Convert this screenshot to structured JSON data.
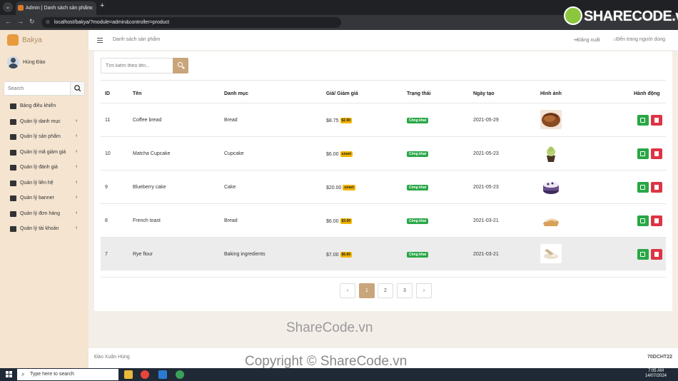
{
  "browser": {
    "tab_title": "Admin | Danh sách sản phẩm",
    "url": "localhost/bakya/?module=admin&controller=product"
  },
  "brand_watermark": "SHARECODE.vn",
  "sidebar": {
    "brand": "Bakya",
    "user_name": "Hùng Đào",
    "search_placeholder": "Search",
    "items": [
      {
        "label": "Bảng điều khiển",
        "icon": "dashboard-icon",
        "chevron": ""
      },
      {
        "label": "Quản lý danh mục",
        "icon": "list-icon",
        "chevron": "‹"
      },
      {
        "label": "Quản lý sản phẩm",
        "icon": "shirt-icon",
        "chevron": "‹"
      },
      {
        "label": "Quản lý mã giảm giá",
        "icon": "gift-icon",
        "chevron": "‹"
      },
      {
        "label": "Quản lý đánh giá",
        "icon": "comment-icon",
        "chevron": "‹"
      },
      {
        "label": "Quản lý liên hệ",
        "icon": "phone-icon",
        "chevron": "‹"
      },
      {
        "label": "Quản lý banner",
        "icon": "image-icon",
        "chevron": "‹"
      },
      {
        "label": "Quản lý đơn hàng",
        "icon": "file-icon",
        "chevron": "‹"
      },
      {
        "label": "Quản lý tài khoản",
        "icon": "user-icon",
        "chevron": "‹"
      }
    ]
  },
  "header": {
    "page_title": "Danh sách sản phẩm",
    "logout": "Đăng xuất",
    "user_site": "Đến trang người dùng"
  },
  "main": {
    "search_placeholder": "Tìm kiếm theo tên...",
    "columns": [
      "ID",
      "Tên",
      "Danh mục",
      "Giá/ Giảm giá",
      "Trạng thái",
      "Ngày tạo",
      "Hình ảnh",
      "Hành động"
    ],
    "rows": [
      {
        "id": "11",
        "name": "Coffee bread",
        "category": "Bread",
        "price": "$8.75",
        "discount": "$2.90",
        "status": "Công khai",
        "date": "2021-05-29",
        "image": "coffee-bread"
      },
      {
        "id": "10",
        "name": "Matcha Cupcake",
        "category": "Cupcake",
        "price": "$6.00",
        "discount": "unset",
        "status": "Công khai",
        "date": "2021-05-23",
        "image": "matcha-cupcake"
      },
      {
        "id": "9",
        "name": "Blueberry cake",
        "category": "Cake",
        "price": "$20.00",
        "discount": "unset",
        "status": "Công khai",
        "date": "2021-05-23",
        "image": "blueberry-cake"
      },
      {
        "id": "8",
        "name": "French toast",
        "category": "Bread",
        "price": "$6.00",
        "discount": "$3.00",
        "status": "Công khai",
        "date": "2021-03-21",
        "image": "french-toast"
      },
      {
        "id": "7",
        "name": "Rye flour",
        "category": "Baking ingredients",
        "price": "$7.00",
        "discount": "$6.60",
        "status": "Công khai",
        "date": "2021-03-21",
        "image": "rye-flour"
      }
    ],
    "pagination": {
      "prev": "‹",
      "pages": [
        "1",
        "2",
        "3"
      ],
      "active": "1",
      "next": "›"
    }
  },
  "watermark_text": "ShareCode.vn",
  "footer": {
    "left": "Đào Xuân Hùng",
    "right": "70DCHT22"
  },
  "copyright_watermark": "Copyright © ShareCode.vn",
  "taskbar": {
    "search_placeholder": "Type here to search",
    "time": "7:05 AM",
    "date": "14/07/2024"
  }
}
